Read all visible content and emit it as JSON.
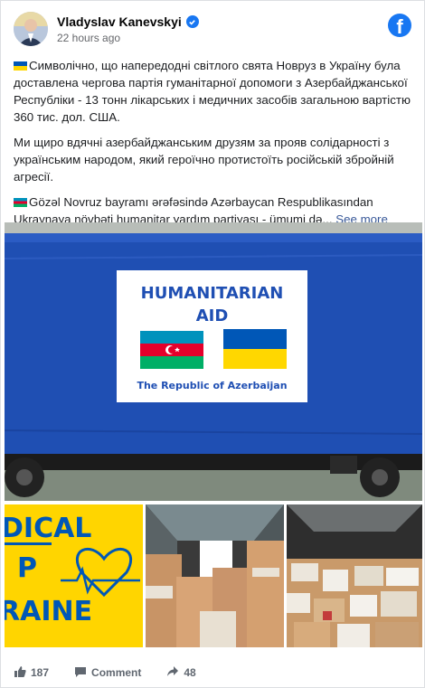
{
  "post": {
    "author": "Vladyslav Kanevskyi",
    "timestamp": "22 hours ago",
    "paragraph1": "Символічно, що напередодні світлого свята Новруз в Україну була доставлена чергова партія гуманітарної допомоги з Азербайджанської Республіки - 13 тонн лікарських і медичних засобів загальною вартістю 360 тис. дол. США.",
    "paragraph2": "Ми щиро вдячні азербайджанським друзям за прояв солідарності з українським народом, який героїчно протистоїть російській збройній агресії.",
    "paragraph3": "Gözəl Novruz bayramı ərəfəsində Azərbaycan Respublikasından Ukraynaya növbəti humanitar yardım partiyası - ümumi də...",
    "see_more": "See more"
  },
  "photo": {
    "sign_line1": "HUMANITARIAN",
    "sign_line2": "AID",
    "sign_country": "The Republic of Azerbaijan"
  },
  "thumb1": {
    "line1": "DICAL",
    "line2": "P",
    "line3": "RAINE"
  },
  "footer": {
    "likes": "187",
    "comment_label": "Comment",
    "shares": "48"
  },
  "colors": {
    "facebook_blue": "#1877f2",
    "truck_blue": "#1f4fb3",
    "ukraine_blue": "#0057b7",
    "ukraine_yellow": "#ffd700"
  }
}
